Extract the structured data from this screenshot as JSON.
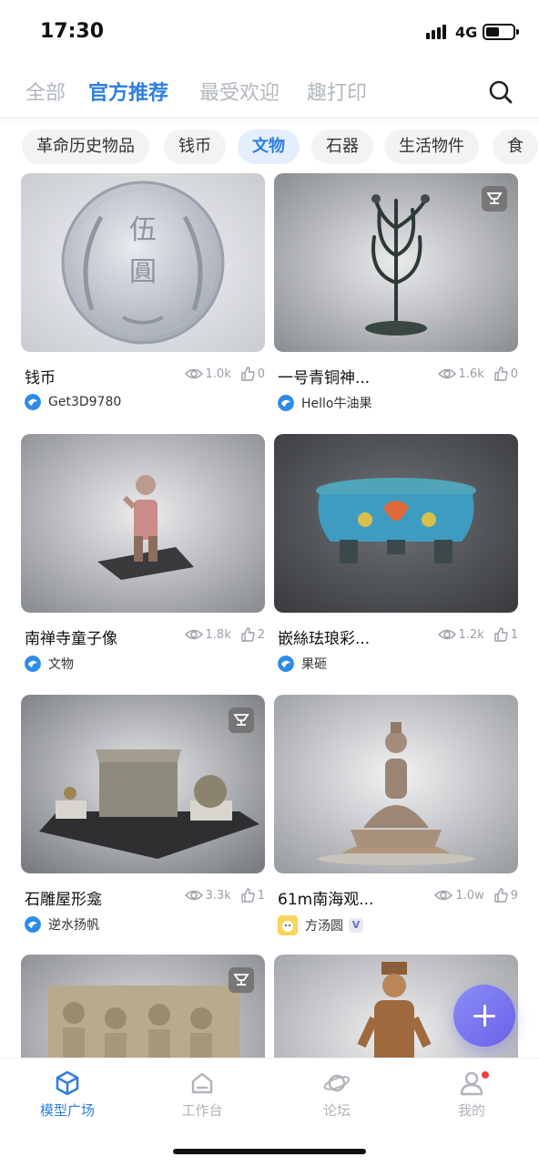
{
  "status": {
    "time": "17:30",
    "network": "4G"
  },
  "top_tabs": [
    "全部",
    "官方推荐",
    "最受欢迎",
    "趣打印"
  ],
  "active_top_tab": "官方推荐",
  "categories": [
    "革命历史物品",
    "钱币",
    "文物",
    "石器",
    "生活物件",
    "食"
  ],
  "active_category": "文物",
  "accent_color": "#2f7fe0",
  "cards": [
    {
      "title": "钱币",
      "views": "1.0k",
      "likes": "0",
      "author": "Get3D9780",
      "has_print_badge": false,
      "icon": "coin-model"
    },
    {
      "title": "一号青铜神...",
      "views": "1.6k",
      "likes": "0",
      "author": "Hello牛油果",
      "has_print_badge": true,
      "icon": "bronze-tree-model"
    },
    {
      "title": "南禅寺童子像",
      "views": "1.8k",
      "likes": "2",
      "author": "文物",
      "has_print_badge": false,
      "icon": "child-statue-model"
    },
    {
      "title": "嵌絲珐琅彩...",
      "views": "1.2k",
      "likes": "1",
      "author": "果砸",
      "has_print_badge": false,
      "icon": "cloisonne-model"
    },
    {
      "title": "石雕屋形龛",
      "views": "3.3k",
      "likes": "1",
      "author": "逆水扬帆",
      "has_print_badge": true,
      "icon": "stone-shrine-model"
    },
    {
      "title": "61m南海观...",
      "views": "1.0w",
      "likes": "9",
      "author": "方汤圆",
      "has_print_badge": false,
      "verified": true,
      "verified_mark": "V",
      "icon": "guanyin-statue-model"
    },
    {
      "has_print_badge": true,
      "icon": "stone-relief-model"
    },
    {
      "has_print_badge": false,
      "icon": "wooden-bodhisattva-model"
    }
  ],
  "bottom_nav": [
    {
      "label": "模型广场",
      "icon": "cube-icon",
      "active": true
    },
    {
      "label": "工作台",
      "icon": "workbench-icon",
      "active": false
    },
    {
      "label": "论坛",
      "icon": "planet-icon",
      "active": false
    },
    {
      "label": "我的",
      "icon": "user-icon",
      "active": false,
      "has_notification": true
    }
  ]
}
